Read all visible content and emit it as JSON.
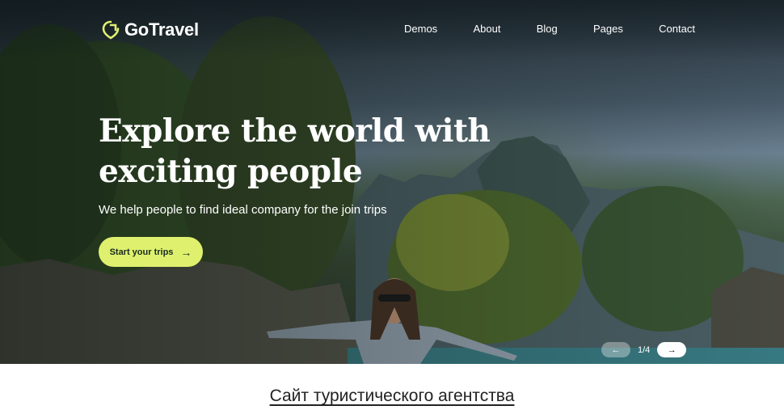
{
  "brand": {
    "name": "GoTravel",
    "accent": "#dff06e"
  },
  "nav": {
    "items": [
      "Demos",
      "About",
      "Blog",
      "Pages",
      "Contact"
    ]
  },
  "hero": {
    "headline_line1": "Explore the world with",
    "headline_line2": "exciting people",
    "subtitle": "We help people to find ideal company for the join trips",
    "cta_label": "Start your trips",
    "cta_icon": "arrow-right-icon"
  },
  "slider": {
    "counter": "1/4",
    "prev_icon": "arrow-left-icon",
    "next_icon": "arrow-right-icon"
  },
  "caption": "Сайт туристического агентства"
}
